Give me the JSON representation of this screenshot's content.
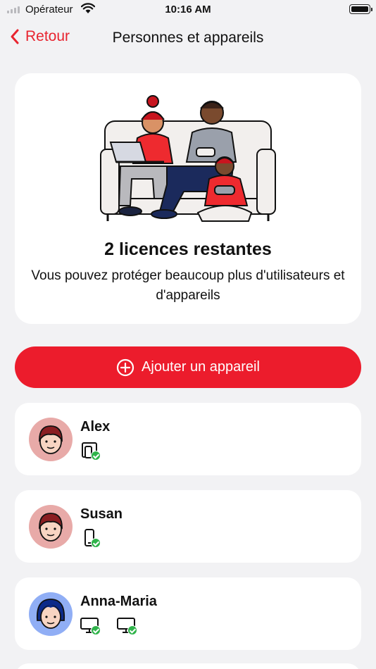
{
  "status": {
    "carrier": "Opérateur",
    "time": "10:16 AM"
  },
  "nav": {
    "back_label": "Retour",
    "title": "Personnes et appareils"
  },
  "hero": {
    "title": "2 licences restantes",
    "subtitle": "Vous pouvez protéger beaucoup plus d'utilisateurs et d'appareils"
  },
  "add_button": {
    "label": "Ajouter un appareil"
  },
  "people": [
    {
      "name": "Alex",
      "avatar_color": "#e8aaa8",
      "hair_color": "#8a1e22",
      "devices": [
        "multi-device-icon"
      ]
    },
    {
      "name": "Susan",
      "avatar_color": "#e8aaa8",
      "hair_color": "#8a1e22",
      "devices": [
        "phone-icon"
      ]
    },
    {
      "name": "Anna-Maria",
      "avatar_color": "#90aef5",
      "hair_color": "#0c2a8a",
      "devices": [
        "monitor-icon",
        "monitor-icon"
      ]
    }
  ],
  "colors": {
    "accent": "#ec1c2c",
    "success": "#2fb34a",
    "background": "#f2f2f4"
  }
}
